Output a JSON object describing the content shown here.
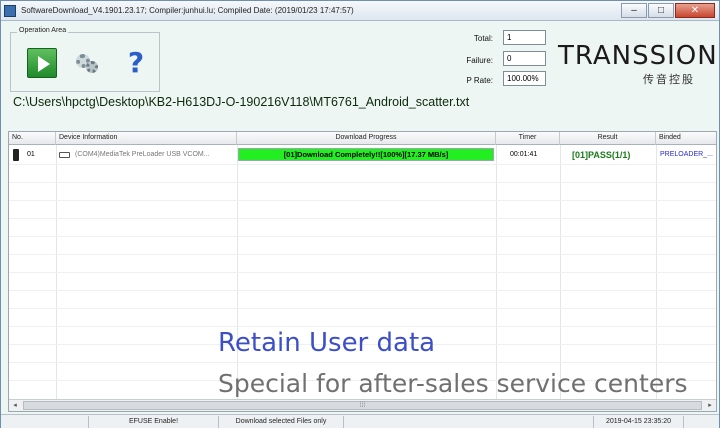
{
  "window": {
    "title": "SoftwareDownload_V4.1901.23.17; Compiler:junhui.lu; Compiled Date: (2019/01/23 17:47:57)",
    "buttons": {
      "minimize": "–",
      "maximize": "□",
      "close": "✕"
    }
  },
  "operation_area": {
    "label": "Operation Area",
    "buttons": [
      {
        "icon": "play-icon"
      },
      {
        "icon": "gear-icon"
      },
      {
        "icon": "help-icon",
        "glyph": "?"
      }
    ]
  },
  "stats": {
    "total_label": "Total:",
    "total_value": "1",
    "failure_label": "Failure:",
    "failure_value": "0",
    "prate_label": "P Rate:",
    "prate_value": "100.00%"
  },
  "logo": {
    "text": "TRANSSION",
    "subtitle": "传音控股"
  },
  "scatter_path": "C:\\Users\\hpctg\\Desktop\\KB2-H613DJ-O-190216V118\\MT6761_Android_scatter.txt",
  "table": {
    "columns": [
      "No.",
      "Device Information",
      "Download Progress",
      "Timer",
      "Result",
      "Binded"
    ],
    "rows": [
      {
        "no": "01",
        "device": "(COM4)MediaTek PreLoader USB VCOM...",
        "progress_text": "[01]Download Completely!![100%][17.37 MB/s]",
        "progress": 1.0,
        "timer": "00:01:41",
        "result": "[01]PASS(1/1)",
        "binded": "PRELOADER_..."
      }
    ]
  },
  "overlay": {
    "line1": "Retain User data",
    "line2": "Special for after-sales service centers"
  },
  "colors": {
    "progress_fill": "#22ee22",
    "result": "#1a7a1a",
    "binded": "#2a2ad0",
    "overlay1": "#3c4fc7",
    "overlay2": "#707070"
  },
  "statusbar": {
    "efuse": "EFUSE Enable!",
    "mode": "Download selected Files only",
    "datetime": "2019-04-15 23:35:20"
  }
}
